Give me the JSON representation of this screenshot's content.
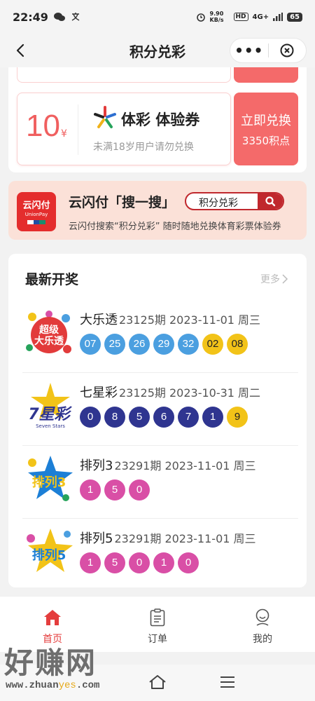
{
  "status_bar": {
    "time": "22:49",
    "network_speed": "9.90 KB/s",
    "hd": "HD",
    "signal": "4G+",
    "battery": "65"
  },
  "nav": {
    "title": "积分兑彩",
    "more_icon": "more-dots-icon",
    "close_icon": "close-circle-icon"
  },
  "coupon": {
    "amount": "10",
    "currency": "¥",
    "name": "体彩 体验券",
    "note": "未满18岁用户请勿兑换",
    "redeem_label": "立即兑换",
    "points": "3350积点"
  },
  "promo": {
    "logo_cn": "云闪付",
    "logo_en": "UnionPay",
    "title": "云闪付「搜一搜」",
    "search_text": "积分兑彩",
    "desc": "云闪付搜索“积分兑彩” 随时随地兑换体育彩票体验券"
  },
  "results": {
    "title": "最新开奖",
    "more": "更多",
    "lotteries": [
      {
        "name": "大乐透",
        "issue": "23125期 2023-11-01 周三",
        "logo_text": "超级 大乐透",
        "balls": [
          {
            "n": "07",
            "color": "#4b9fe0"
          },
          {
            "n": "25",
            "color": "#4b9fe0"
          },
          {
            "n": "26",
            "color": "#4b9fe0"
          },
          {
            "n": "29",
            "color": "#4b9fe0"
          },
          {
            "n": "32",
            "color": "#4b9fe0"
          },
          {
            "n": "02",
            "color": "#f2c318"
          },
          {
            "n": "08",
            "color": "#f2c318"
          }
        ]
      },
      {
        "name": "七星彩",
        "issue": "23125期 2023-10-31 周二",
        "logo_text": "7星彩",
        "balls": [
          {
            "n": "0",
            "color": "#2f3590"
          },
          {
            "n": "8",
            "color": "#2f3590"
          },
          {
            "n": "5",
            "color": "#2f3590"
          },
          {
            "n": "6",
            "color": "#2f3590"
          },
          {
            "n": "7",
            "color": "#2f3590"
          },
          {
            "n": "1",
            "color": "#2f3590"
          },
          {
            "n": "9",
            "color": "#f2c318"
          }
        ]
      },
      {
        "name": "排列3",
        "issue": "23291期 2023-11-01 周三",
        "logo_text": "排列3",
        "balls": [
          {
            "n": "1",
            "color": "#d94fa6"
          },
          {
            "n": "5",
            "color": "#d94fa6"
          },
          {
            "n": "0",
            "color": "#d94fa6"
          }
        ]
      },
      {
        "name": "排列5",
        "issue": "23291期 2023-11-01 周三",
        "logo_text": "排列5",
        "balls": [
          {
            "n": "1",
            "color": "#d94fa6"
          },
          {
            "n": "5",
            "color": "#d94fa6"
          },
          {
            "n": "0",
            "color": "#d94fa6"
          },
          {
            "n": "1",
            "color": "#d94fa6"
          },
          {
            "n": "0",
            "color": "#d94fa6"
          }
        ]
      }
    ]
  },
  "tabbar": {
    "items": [
      {
        "label": "首页",
        "icon": "home-icon",
        "active": true
      },
      {
        "label": "订单",
        "icon": "order-list-icon",
        "active": false
      },
      {
        "label": "我的",
        "icon": "profile-icon",
        "active": false
      }
    ]
  },
  "watermark": {
    "big": "好赚网",
    "url_pre": "www.zhuan",
    "url_mid": "yes",
    "url_post": ".com"
  },
  "colors": {
    "accent": "#f46a6a",
    "brand_red": "#e43d3d",
    "search_red": "#c0282d",
    "promo_bg": "#fbe1d8"
  }
}
